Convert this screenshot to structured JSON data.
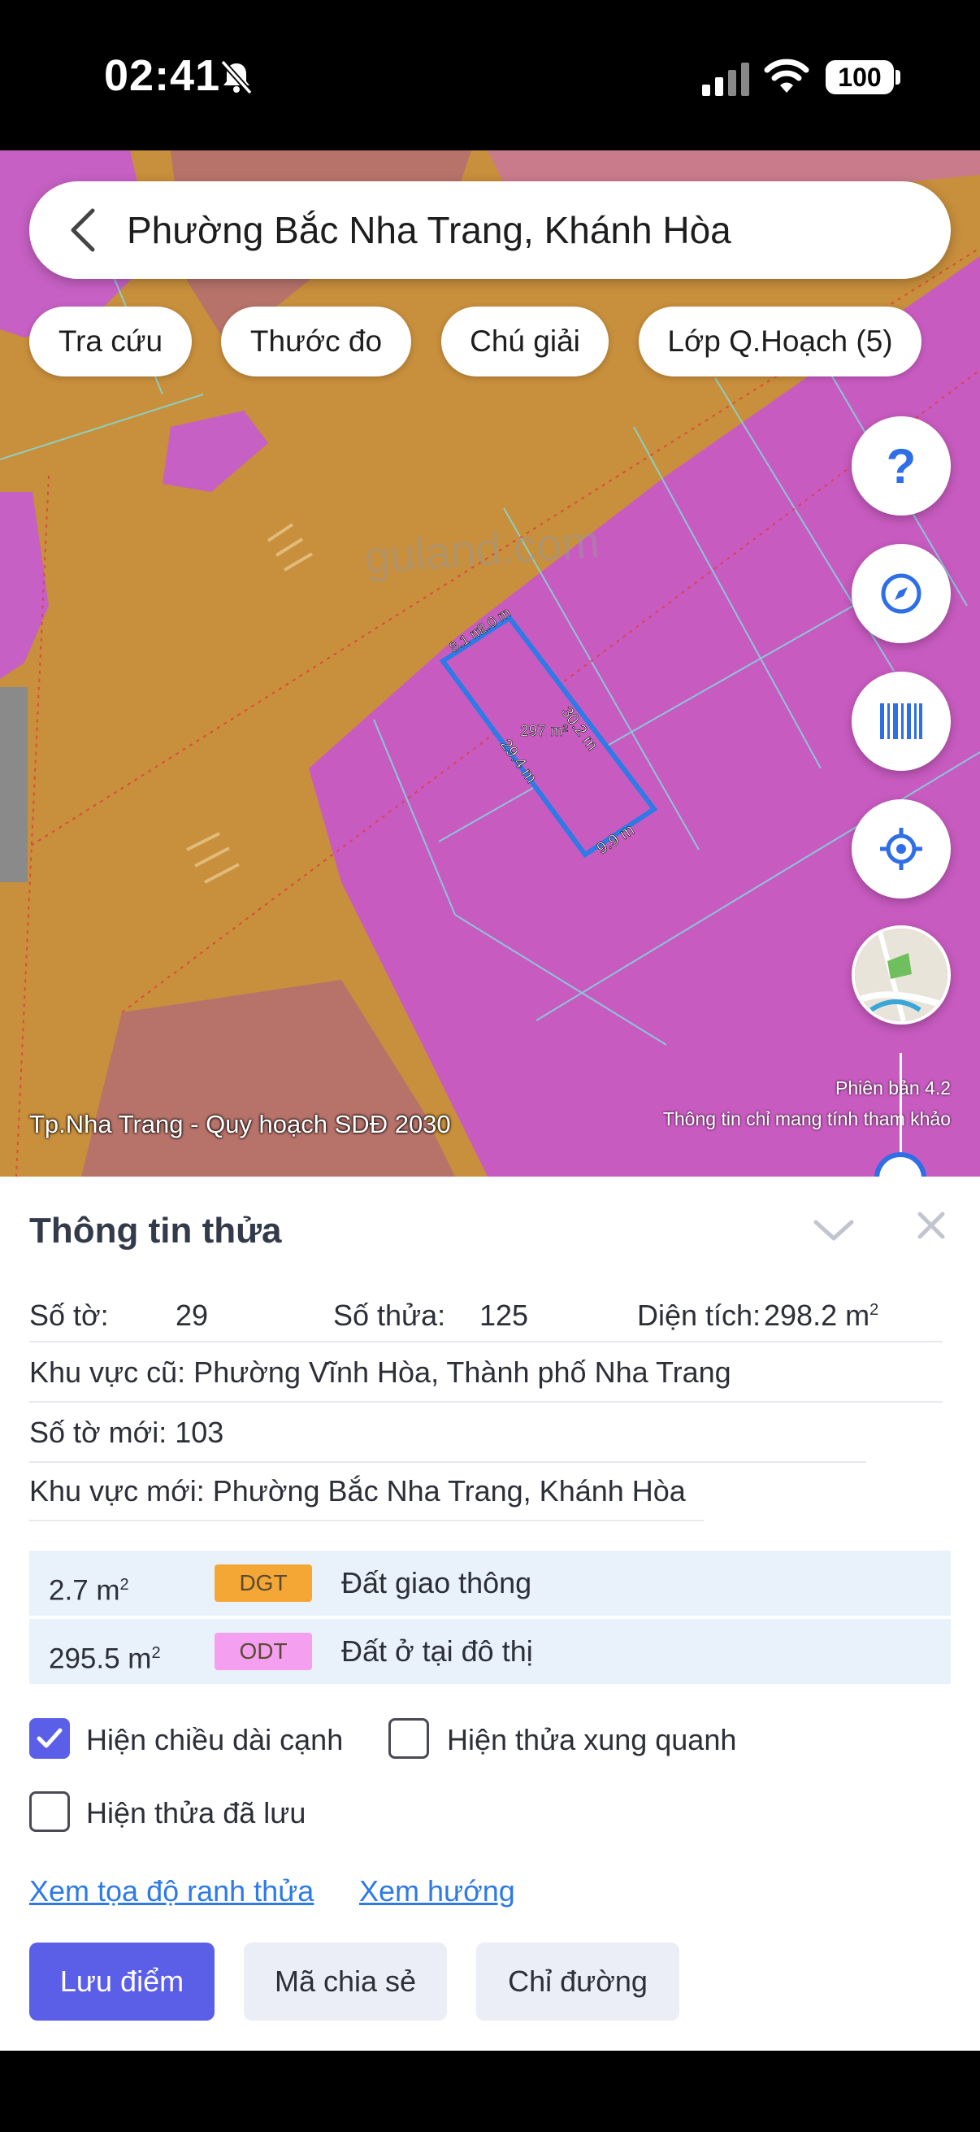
{
  "status_bar": {
    "time": "02:41",
    "battery": "100",
    "icons": [
      "bell-slash-icon",
      "signal-icon",
      "wifi-icon",
      "battery-icon"
    ]
  },
  "search": {
    "text": "Phường Bắc Nha Trang, Khánh Hòa"
  },
  "chips": [
    "Tra cứu",
    "Thước đo",
    "Chú giải",
    "Lớp Q.Hoạch (5)"
  ],
  "map": {
    "watermark": "guland.com",
    "edge_labels": [
      "8.1 m",
      "2.0 m",
      "30.2 m",
      "29.4 m",
      "9.9 m"
    ],
    "area_label": "297 m²",
    "caption": "Tp.Nha Trang - Quy hoạch SDĐ 2030",
    "version": "Phiên bản 4.2",
    "disclaimer": "Thông tin chỉ mang tính tham khảo",
    "fab_help": "?",
    "colors": {
      "road": "#c88f3c",
      "residential": "#c85bc0",
      "parcel_outline": "#2e7ae6"
    }
  },
  "sheet": {
    "title": "Thông tin thửa",
    "so_to_label": "Số tờ:",
    "so_to_value": "29",
    "so_thua_label": "Số thửa:",
    "so_thua_value": "125",
    "dien_tich_label": "Diện tích:",
    "dien_tich_value": "298.2 m",
    "khu_vuc_cu": "Khu vực cũ: Phường Vĩnh Hòa, Thành phố Nha Trang",
    "so_to_moi": "Số tờ mới: 103",
    "khu_vuc_moi": "Khu vực mới: Phường Bắc Nha Trang, Khánh Hòa",
    "land_uses": [
      {
        "area": "2.7 m",
        "code": "DGT",
        "name": "Đất giao thông",
        "color": "#f5a735"
      },
      {
        "area": "295.5 m",
        "code": "ODT",
        "name": "Đất ở tại đô thị",
        "color": "#f59ff0"
      }
    ],
    "checkboxes": [
      {
        "label": "Hiện chiều dài cạnh",
        "checked": true
      },
      {
        "label": "Hiện thửa xung quanh",
        "checked": false
      },
      {
        "label": "Hiện thửa đã lưu",
        "checked": false
      }
    ],
    "links": [
      "Xem tọa độ ranh thửa",
      "Xem hướng"
    ],
    "buttons": {
      "primary": "Lưu điểm",
      "share": "Mã chia sẻ",
      "directions": "Chỉ đường"
    }
  }
}
